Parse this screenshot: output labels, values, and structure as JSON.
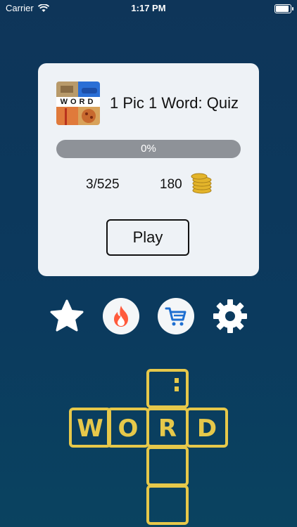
{
  "status_bar": {
    "carrier": "Carrier",
    "time": "1:17 PM"
  },
  "card": {
    "thumbnail_word": "WORD",
    "title": "1 Pic 1 Word: Quiz",
    "progress": {
      "percent": 0,
      "label": "0%"
    },
    "level": "3/525",
    "coins": "180",
    "play_label": "Play"
  },
  "actions": [
    {
      "icon": "star-icon"
    },
    {
      "icon": "fire-icon"
    },
    {
      "icon": "cart-icon"
    },
    {
      "icon": "gear-icon"
    }
  ],
  "logo_letters": [
    "W",
    "O",
    "R",
    "D"
  ],
  "colors": {
    "accent_gold": "#e6c84a",
    "cart_blue": "#1f6fd1",
    "fire_red": "#ff5a3c"
  }
}
